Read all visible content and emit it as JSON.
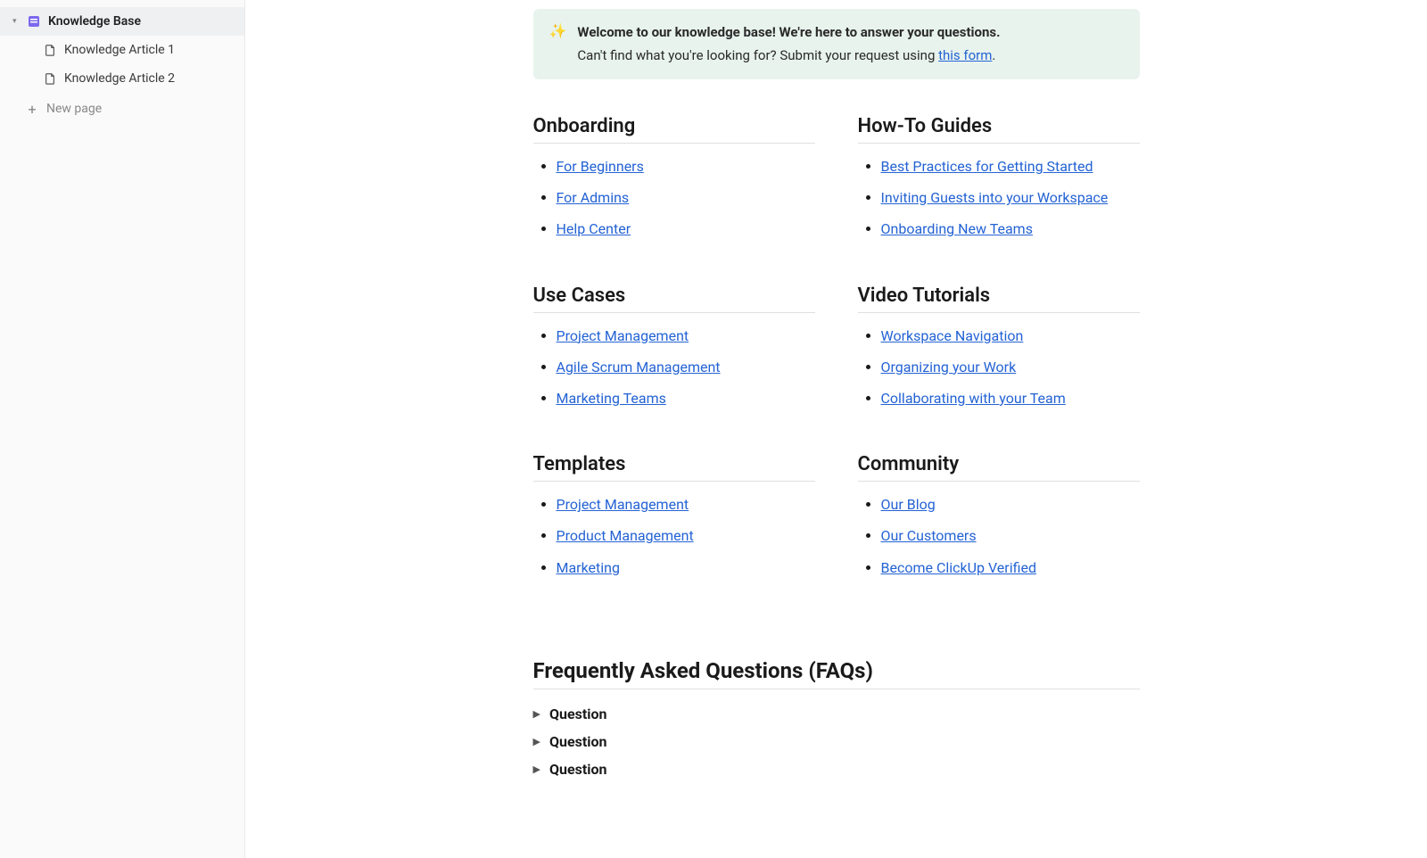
{
  "sidebar": {
    "root": {
      "label": "Knowledge Base"
    },
    "items": [
      {
        "label": "Knowledge Article 1"
      },
      {
        "label": "Knowledge Article 2"
      }
    ],
    "new_page_label": "New page"
  },
  "banner": {
    "icon": "✨",
    "strong": "Welcome to our knowledge base! We're here to answer your questions.",
    "sub_prefix": "Can't find what you're looking for? Submit your request using ",
    "link_text": "this form",
    "sub_suffix": "."
  },
  "sections": [
    {
      "title": "Onboarding",
      "links": [
        "For Beginners",
        "For Admins",
        "Help Center"
      ]
    },
    {
      "title": "How-To Guides",
      "links": [
        "Best Practices for Getting Started",
        "Inviting Guests into your Workspace",
        "Onboarding New Teams"
      ]
    },
    {
      "title": "Use Cases",
      "links": [
        "Project Management",
        "Agile Scrum Management",
        "Marketing Teams"
      ]
    },
    {
      "title": "Video Tutorials",
      "links": [
        "Workspace Navigation",
        "Organizing your Work",
        "Collaborating with your Team"
      ]
    },
    {
      "title": "Templates",
      "links": [
        "Project Management",
        "Product Management",
        "Marketing"
      ]
    },
    {
      "title": "Community",
      "links": [
        "Our Blog",
        "Our Customers",
        "Become ClickUp Verified"
      ]
    }
  ],
  "faq": {
    "title": "Frequently Asked Questions (FAQs)",
    "items": [
      "Question",
      "Question",
      "Question"
    ]
  }
}
